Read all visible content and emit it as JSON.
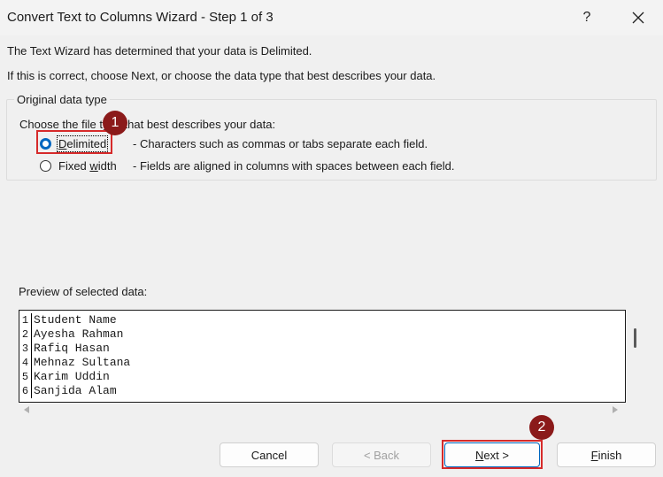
{
  "window": {
    "title": "Convert Text to Columns Wizard - Step 1 of 3",
    "help_label": "?",
    "close_icon": "close-icon"
  },
  "intro": {
    "line1": "The Text Wizard has determined that your data is Delimited.",
    "line2": "If this is correct, choose Next, or choose the data type that best describes your data."
  },
  "original_data_type": {
    "legend": "Original data type",
    "choose_label": "Choose the file type that best describes your data:",
    "options": [
      {
        "label_pre": "",
        "label_key": "D",
        "label_post": "elimited",
        "description": "- Characters such as commas or tabs separate each field.",
        "selected": true
      },
      {
        "label_pre": "Fixed ",
        "label_key": "w",
        "label_post": "idth",
        "description": "- Fields are aligned in columns with spaces between each field.",
        "selected": false
      }
    ]
  },
  "preview": {
    "label": "Preview of selected data:",
    "rows": [
      {
        "num": "1",
        "text": "Student Name"
      },
      {
        "num": "2",
        "text": "Ayesha Rahman"
      },
      {
        "num": "3",
        "text": "Rafiq Hasan"
      },
      {
        "num": "4",
        "text": "Mehnaz Sultana"
      },
      {
        "num": "5",
        "text": "Karim Uddin"
      },
      {
        "num": "6",
        "text": "Sanjida Alam"
      }
    ]
  },
  "buttons": {
    "cancel": "Cancel",
    "back_key": "",
    "back": "< Back",
    "next_key": "N",
    "next_rest": "ext >",
    "finish_key": "F",
    "finish_rest": "inish"
  },
  "annotations": {
    "badge1": "1",
    "badge2": "2",
    "highlight_color": "#d62a2a",
    "badge_color": "#8b1a1a"
  },
  "colors": {
    "accent": "#0067c0",
    "dialog_bg": "#f0f0f0"
  }
}
